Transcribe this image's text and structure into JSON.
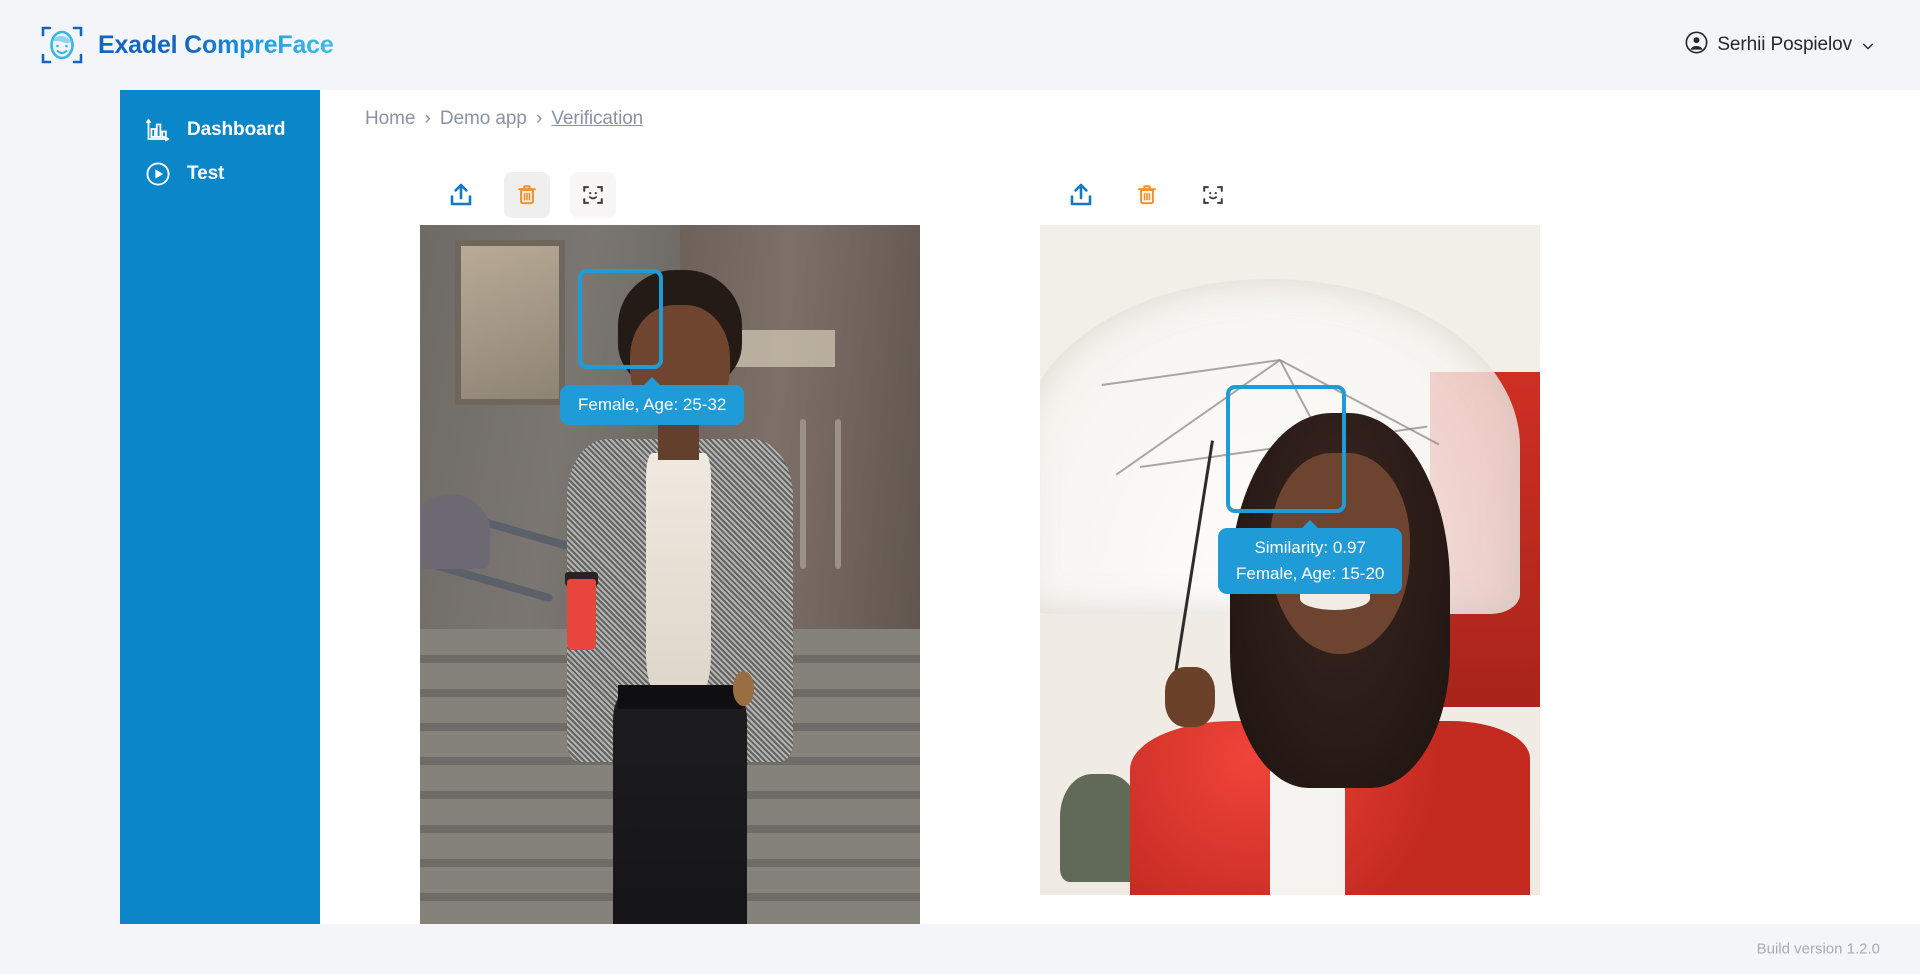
{
  "header": {
    "brand_title": "Exadel CompreFace",
    "brand_icon": "face-scan-logo-icon",
    "user_name": "Serhii Pospielov",
    "user_avatar_icon": "user-circle-icon",
    "chevron_icon": "chevron-down-icon"
  },
  "sidebar": {
    "items": [
      {
        "label": "Dashboard",
        "icon": "bar-chart-icon"
      },
      {
        "label": "Test",
        "icon": "play-circle-icon"
      }
    ]
  },
  "breadcrumb": {
    "items": [
      {
        "label": "Home",
        "current": false
      },
      {
        "label": "Demo app",
        "current": false
      },
      {
        "label": "Verification",
        "current": true
      }
    ],
    "separator": "›"
  },
  "panes": {
    "left": {
      "toolbar": [
        {
          "icon": "upload-icon",
          "label": "Upload",
          "style": "plain"
        },
        {
          "icon": "trash-icon",
          "label": "Delete",
          "style": "on-img-dark"
        },
        {
          "icon": "face-scan-icon",
          "label": "Detect face",
          "style": "on-img-light"
        }
      ],
      "face": {
        "tooltip_lines": [
          "Female, Age: 25-32"
        ]
      }
    },
    "right": {
      "toolbar": [
        {
          "icon": "upload-icon",
          "label": "Upload",
          "style": "plain"
        },
        {
          "icon": "trash-icon",
          "label": "Delete",
          "style": "plain"
        },
        {
          "icon": "face-scan-icon",
          "label": "Detect face",
          "style": "plain"
        }
      ],
      "face": {
        "tooltip_lines": [
          "Similarity: 0.97",
          "Female, Age: 15-20"
        ]
      }
    }
  },
  "footer": {
    "build_version": "Build version 1.2.0"
  },
  "colors": {
    "accent_blue": "#1f9cd8",
    "sidebar_blue": "#0b86c9",
    "page_bg": "#f4f5f9",
    "upload_icon": "#1479c4",
    "trash_icon": "#f4922a",
    "scan_icon": "#3d3d3d",
    "breadcrumb_text": "#8a92a6",
    "footer_text": "#a7acb8"
  }
}
